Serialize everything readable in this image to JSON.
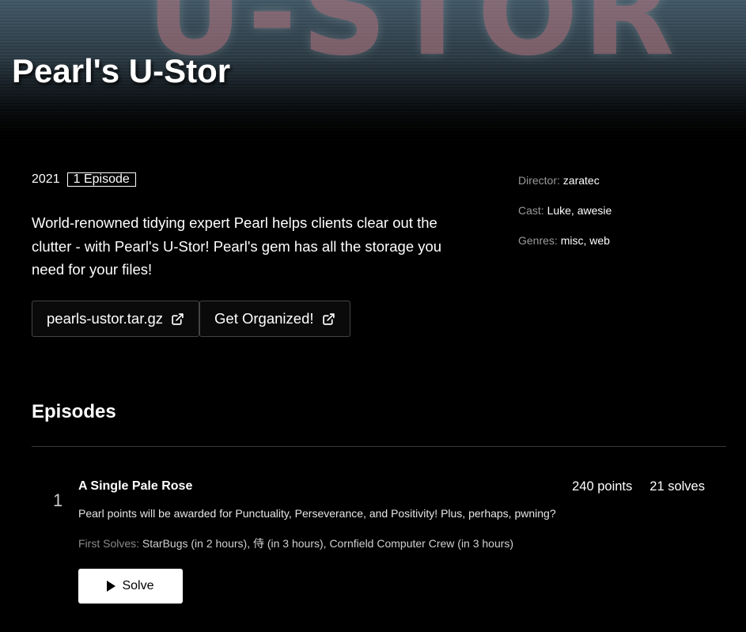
{
  "challenge": {
    "title": "Pearl's U-Stor",
    "year": "2021",
    "episode_badge": "1 Episode",
    "description": "World-renowned tidying expert Pearl helps clients clear out the clutter - with Pearl's U-Stor! Pearl's gem has all the storage you need for your files!",
    "links": [
      {
        "label": "pearls-ustor.tar.gz",
        "icon": "external-link-icon"
      },
      {
        "label": "Get Organized!",
        "icon": "external-link-icon"
      }
    ]
  },
  "details": {
    "director_label": "Director:",
    "director": "zaratec",
    "cast_label": "Cast:",
    "cast": "Luke, awesie",
    "genres_label": "Genres:",
    "genres": "misc, web"
  },
  "episodes": {
    "heading": "Episodes",
    "items": [
      {
        "number": "1",
        "title": "A Single Pale Rose",
        "points": "240 points",
        "solves": "21 solves",
        "description": "Pearl points will be awarded for Punctuality, Perseverance, and Positivity! Plus, perhaps, pwning?",
        "first_solves_label": "First Solves:",
        "first_solves": "StarBugs (in 2 hours), 侍 (in 3 hours), Cornfield Computer Crew (in 3 hours)",
        "solve_label": "Solve"
      }
    ]
  },
  "colors": {
    "background": "#000000",
    "accent": "#ffffff",
    "muted": "#9a9a9a"
  }
}
